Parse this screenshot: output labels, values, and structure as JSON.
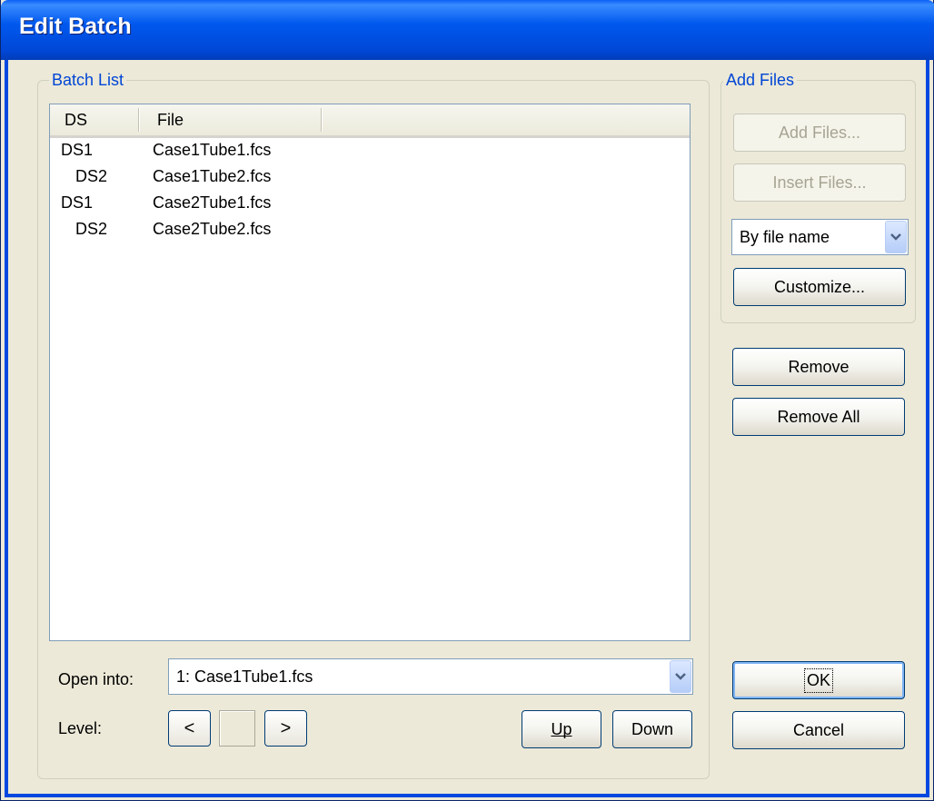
{
  "window": {
    "title": "Edit Batch"
  },
  "batch_list": {
    "legend": "Batch List",
    "columns": [
      "DS",
      "File"
    ],
    "rows": [
      {
        "ds": "DS1",
        "file": "Case1Tube1.fcs",
        "indent": 0
      },
      {
        "ds": "DS2",
        "file": "Case1Tube2.fcs",
        "indent": 1
      },
      {
        "ds": "DS1",
        "file": "Case2Tube1.fcs",
        "indent": 0
      },
      {
        "ds": "DS2",
        "file": "Case2Tube2.fcs",
        "indent": 1
      }
    ],
    "open_into_label": "Open into:",
    "open_into_value": "1: Case1Tube1.fcs",
    "level_label": "Level:",
    "level_prev": "<",
    "level_next": ">",
    "up_label": "Up",
    "down_label": "Down"
  },
  "add_files": {
    "legend": "Add Files",
    "add_files_label": "Add Files...",
    "insert_files_label": "Insert Files...",
    "sort_value": "By file name",
    "customize_label": "Customize..."
  },
  "actions": {
    "remove_label": "Remove",
    "remove_all_label": "Remove All",
    "ok_label": "OK",
    "cancel_label": "Cancel"
  },
  "colors": {
    "titlebar": "#0058ee",
    "legend_text": "#0046d5",
    "dialog_bg": "#ece9d8"
  }
}
